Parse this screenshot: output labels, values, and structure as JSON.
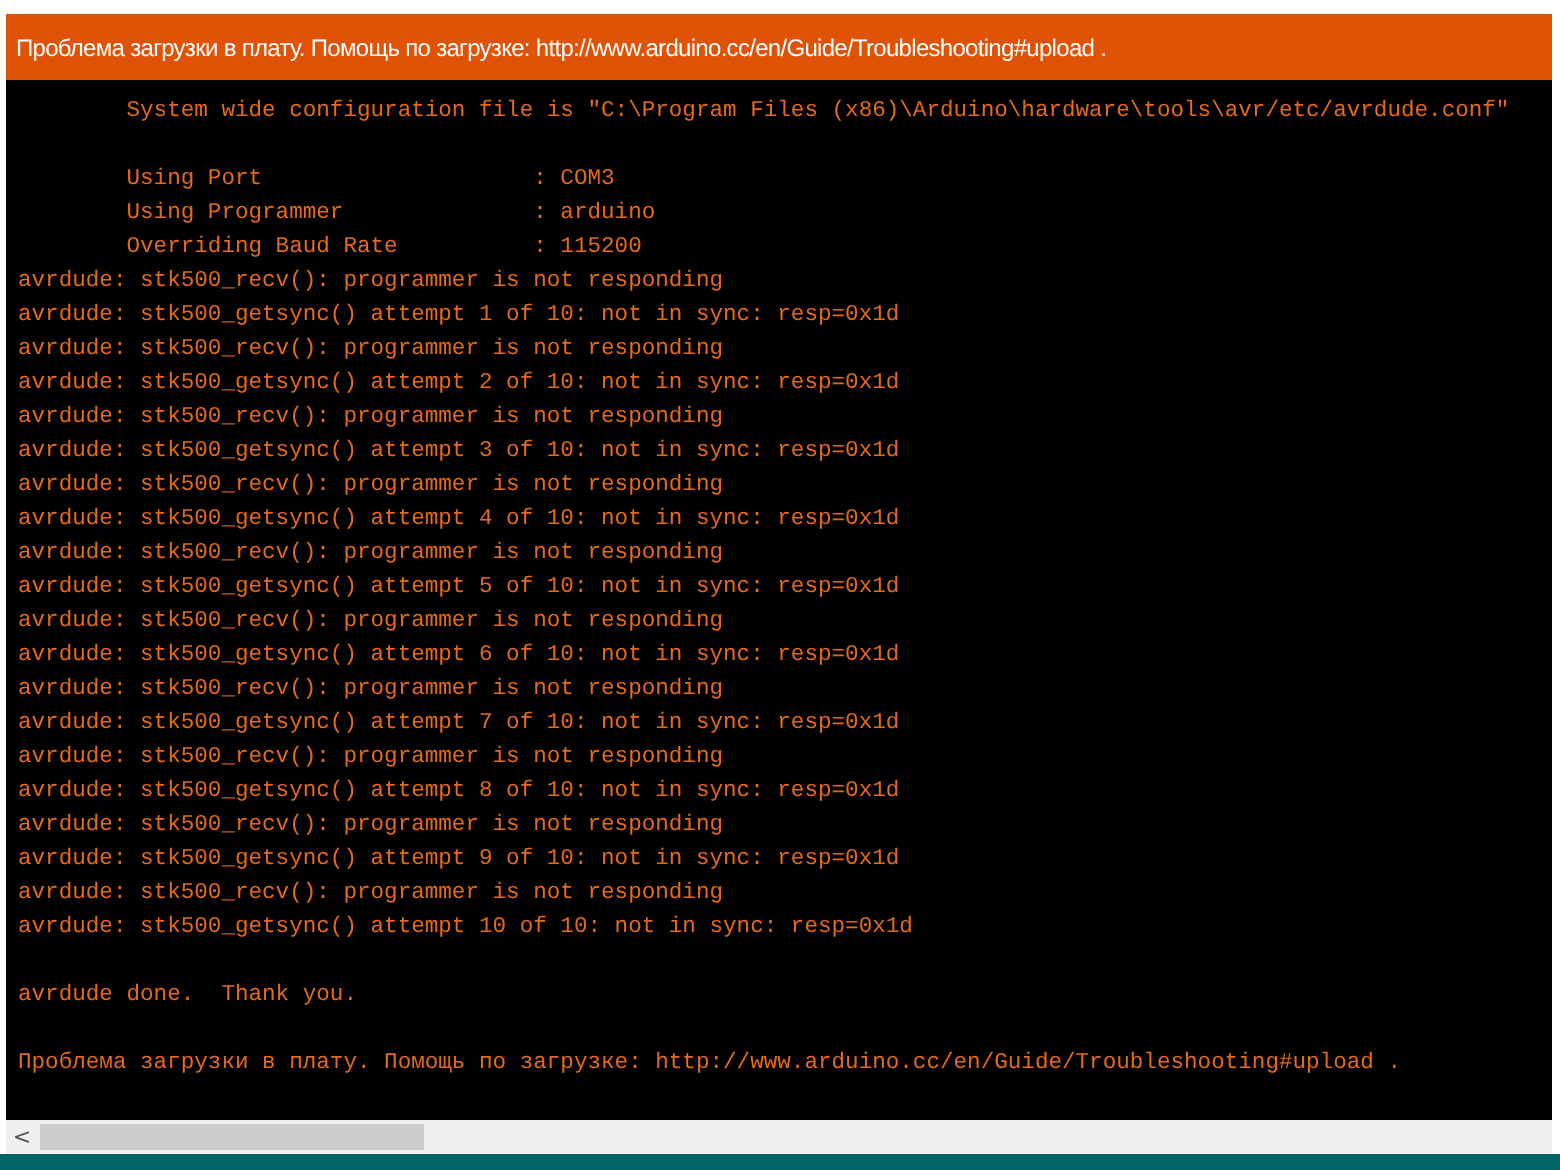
{
  "status_bar": {
    "message": "Проблема загрузки в плату. Помощь по загрузке: http://www.arduino.cc/en/Guide/Troubleshooting#upload ."
  },
  "console": {
    "blocks": [
      [
        "        System wide configuration file is \"C:\\Program Files (x86)\\Arduino\\hardware\\tools\\avr/etc/avrdude.conf\""
      ],
      [
        "        Using Port                    : COM3",
        "        Using Programmer              : arduino",
        "        Overriding Baud Rate          : 115200",
        "avrdude: stk500_recv(): programmer is not responding",
        "avrdude: stk500_getsync() attempt 1 of 10: not in sync: resp=0x1d",
        "avrdude: stk500_recv(): programmer is not responding",
        "avrdude: stk500_getsync() attempt 2 of 10: not in sync: resp=0x1d",
        "avrdude: stk500_recv(): programmer is not responding",
        "avrdude: stk500_getsync() attempt 3 of 10: not in sync: resp=0x1d",
        "avrdude: stk500_recv(): programmer is not responding",
        "avrdude: stk500_getsync() attempt 4 of 10: not in sync: resp=0x1d",
        "avrdude: stk500_recv(): programmer is not responding",
        "avrdude: stk500_getsync() attempt 5 of 10: not in sync: resp=0x1d",
        "avrdude: stk500_recv(): programmer is not responding",
        "avrdude: stk500_getsync() attempt 6 of 10: not in sync: resp=0x1d",
        "avrdude: stk500_recv(): programmer is not responding",
        "avrdude: stk500_getsync() attempt 7 of 10: not in sync: resp=0x1d",
        "avrdude: stk500_recv(): programmer is not responding",
        "avrdude: stk500_getsync() attempt 8 of 10: not in sync: resp=0x1d",
        "avrdude: stk500_recv(): programmer is not responding",
        "avrdude: stk500_getsync() attempt 9 of 10: not in sync: resp=0x1d",
        "avrdude: stk500_recv(): programmer is not responding",
        "avrdude: stk500_getsync() attempt 10 of 10: not in sync: resp=0x1d"
      ],
      [
        "avrdude done.  Thank you."
      ],
      [
        "Проблема загрузки в плату. Помощь по загрузке: http://www.arduino.cc/en/Guide/Troubleshooting#upload ."
      ]
    ]
  },
  "scrollbar": {
    "arrow": "<"
  }
}
